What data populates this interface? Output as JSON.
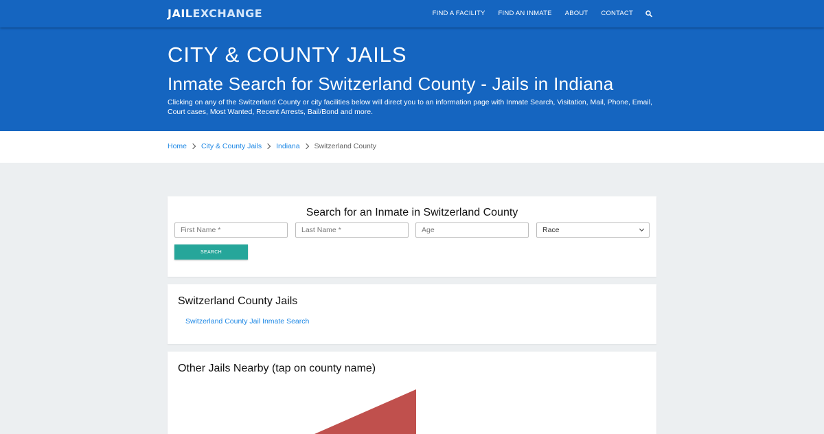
{
  "brand": {
    "part1": "JAIL",
    "part2": "EXCHANGE"
  },
  "nav": {
    "items": [
      "FIND A FACILITY",
      "FIND AN INMATE",
      "ABOUT",
      "CONTACT"
    ],
    "search_icon": "search-icon"
  },
  "hero": {
    "title": "CITY & COUNTY JAILS",
    "subtitle": "Inmate Search for Switzerland County - Jails in Indiana",
    "description": "Clicking on any of the Switzerland County or city facilities below will direct you to an information page with Inmate Search, Visitation, Mail, Phone, Email, Court cases, Most Wanted, Recent Arrests, Bail/Bond and more."
  },
  "breadcrumb": {
    "items": [
      "Home",
      "City & County Jails",
      "Indiana"
    ],
    "current": "Switzerland County"
  },
  "search": {
    "heading": "Search for an Inmate in Switzerland County",
    "first_name_placeholder": "First Name *",
    "last_name_placeholder": "Last Name *",
    "age_placeholder": "Age",
    "race_selected": "Race",
    "button_label": "SEARCH"
  },
  "jails": {
    "heading": "Switzerland County Jails",
    "links": [
      "Switzerland County Jail Inmate Search"
    ]
  },
  "nearby": {
    "heading": "Other Jails Nearby (tap on county name)",
    "map_color": "#c0504d"
  },
  "colors": {
    "primary": "#1565c0",
    "accent": "#26a69a",
    "link": "#1e88e5"
  }
}
